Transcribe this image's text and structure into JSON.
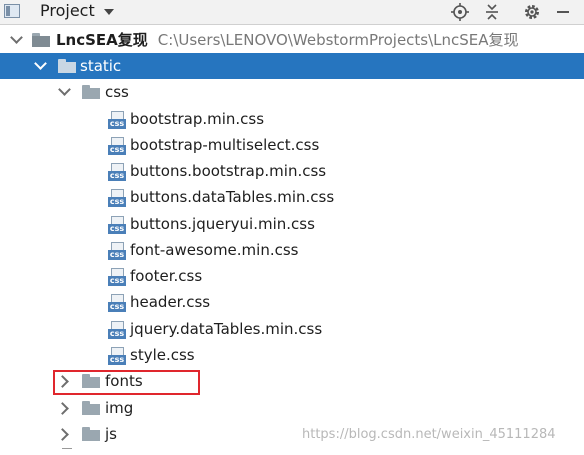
{
  "toolbar": {
    "title": "Project",
    "icons": [
      "project-view-icon",
      "dropdown-arrow-icon",
      "locate-target-icon",
      "collapse-all-icon",
      "gear-icon",
      "minimize-icon"
    ]
  },
  "tree": {
    "root": {
      "name": "LncSEA复现",
      "path": "C:\\Users\\LENOVO\\WebstormProjects\\LncSEA复现"
    },
    "static": {
      "name": "static"
    },
    "css": {
      "name": "css",
      "files": [
        "bootstrap.min.css",
        "bootstrap-multiselect.css",
        "buttons.bootstrap.min.css",
        "buttons.dataTables.min.css",
        "buttons.jqueryui.min.css",
        "font-awesome.min.css",
        "footer.css",
        "header.css",
        "jquery.dataTables.min.css",
        "style.css"
      ],
      "file_icon_text": "css"
    },
    "collapsed_folders": [
      "fonts",
      "img",
      "js"
    ]
  },
  "watermark": "https://blog.csdn.net/weixin_45111284",
  "colors": {
    "selection": "#2675bf",
    "highlight_border": "#e0262d",
    "folder": "#9aa7b0",
    "css_icon": "#4a7fb8"
  }
}
